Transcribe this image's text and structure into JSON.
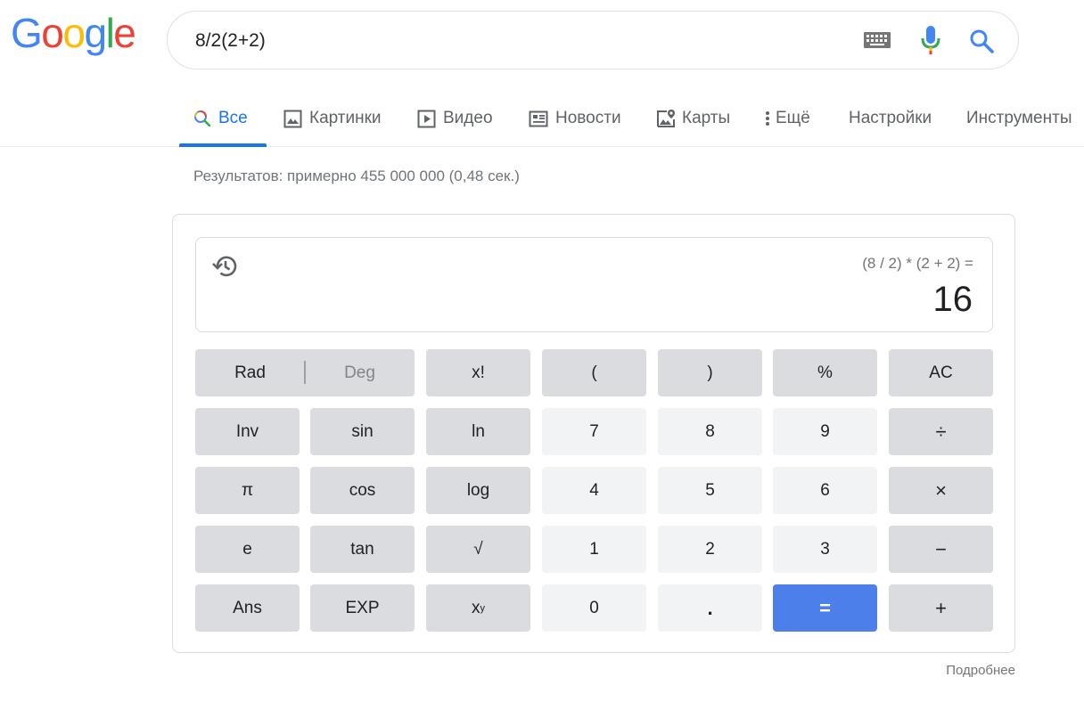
{
  "logo": {
    "letters": [
      "G",
      "o",
      "o",
      "g",
      "l",
      "e"
    ],
    "colors": [
      "#4285f4",
      "#ea4335",
      "#fbbc05",
      "#4285f4",
      "#34a853",
      "#ea4335"
    ]
  },
  "search": {
    "query": "8/2(2+2)"
  },
  "tabs": [
    {
      "label": "Все",
      "icon": "search-icon"
    },
    {
      "label": "Картинки",
      "icon": "image-icon"
    },
    {
      "label": "Видео",
      "icon": "video-icon"
    },
    {
      "label": "Новости",
      "icon": "news-icon"
    },
    {
      "label": "Карты",
      "icon": "map-icon"
    },
    {
      "label": "Ещё",
      "icon": "more-vert-icon"
    },
    {
      "label": "Настройки"
    },
    {
      "label": "Инструменты"
    }
  ],
  "stats": "Результатов: примерно 455 000 000 (0,48 сек.)",
  "calculator": {
    "expression": "(8 / 2) * (2 + 2) =",
    "result": "16",
    "rad": "Rad",
    "deg": "Deg",
    "keys": {
      "fact": "x!",
      "lparen": "(",
      "rparen": ")",
      "percent": "%",
      "ac": "AC",
      "inv": "Inv",
      "sin": "sin",
      "ln": "ln",
      "n7": "7",
      "n8": "8",
      "n9": "9",
      "div": "÷",
      "pi": "π",
      "cos": "cos",
      "log": "log",
      "n4": "4",
      "n5": "5",
      "n6": "6",
      "mul": "×",
      "e": "e",
      "tan": "tan",
      "sqrt": "√",
      "n1": "1",
      "n2": "2",
      "n3": "3",
      "minus": "−",
      "ans": "Ans",
      "exp": "EXP",
      "pow_base": "x",
      "pow_sup": "y",
      "n0": "0",
      "dot": ".",
      "eq": "=",
      "plus": "+"
    },
    "accent_color": "#4d7feb"
  },
  "more_link": "Подробнее"
}
